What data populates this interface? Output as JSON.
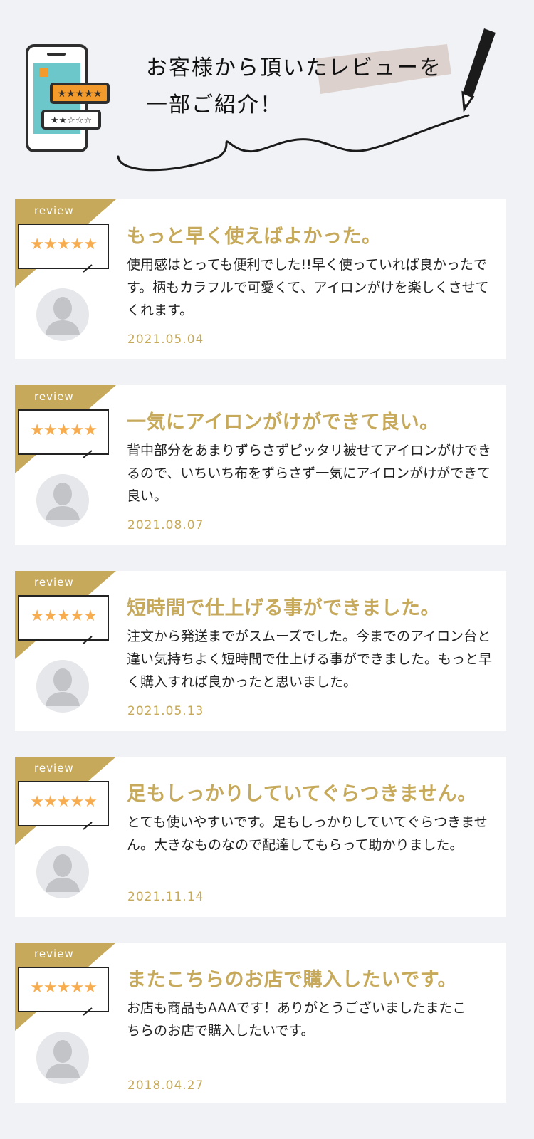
{
  "header": {
    "title_line1": "お客様から頂いたレビューを",
    "title_line2": "一部ご紹介！"
  },
  "colors": {
    "accent_gold": "#c6a95a",
    "star_orange": "#f7ac4f",
    "background": "#f1f2f6"
  },
  "reviews": [
    {
      "label": "review",
      "stars": "★★★★★",
      "rating": 5,
      "title": "もっと早く使えばよかった。",
      "body": "使用感はとっても便利でした!!早く使っていれば良かったです。柄もカラフルで可愛くて、アイロンがけを楽しくさせてくれます。",
      "date": "2021.05.04"
    },
    {
      "label": "review",
      "stars": "★★★★★",
      "rating": 5,
      "title": "一気にアイロンがけができて良い。",
      "body": "背中部分をあまりずらさずピッタリ被せてアイロンがけできるので、いちいち布をずらさず一気にアイロンがけができて良い。",
      "date": "2021.08.07"
    },
    {
      "label": "review",
      "stars": "★★★★★",
      "rating": 5,
      "title": "短時間で仕上げる事ができました。",
      "body": "注文から発送までがスムーズでした。今までのアイロン台と違い気持ちよく短時間で仕上げる事ができました。もっと早く購入すれば良かったと思いました。",
      "date": "2021.05.13"
    },
    {
      "label": "review",
      "stars": "★★★★★",
      "rating": 5,
      "title": "足もしっかりしていてぐらつきません。",
      "body": "とても使いやすいです。足もしっかりしていてぐらつきません。大きなものなので配達してもらって助かりました。",
      "date": "2021.11.14"
    },
    {
      "label": "review",
      "stars": "★★★★★",
      "rating": 5,
      "title": "またこちらのお店で購入したいです。",
      "body": "お店も商品もAAAです！ありがとうございましたまたこちらのお店で購入したいです。",
      "date": "2018.04.27"
    }
  ]
}
